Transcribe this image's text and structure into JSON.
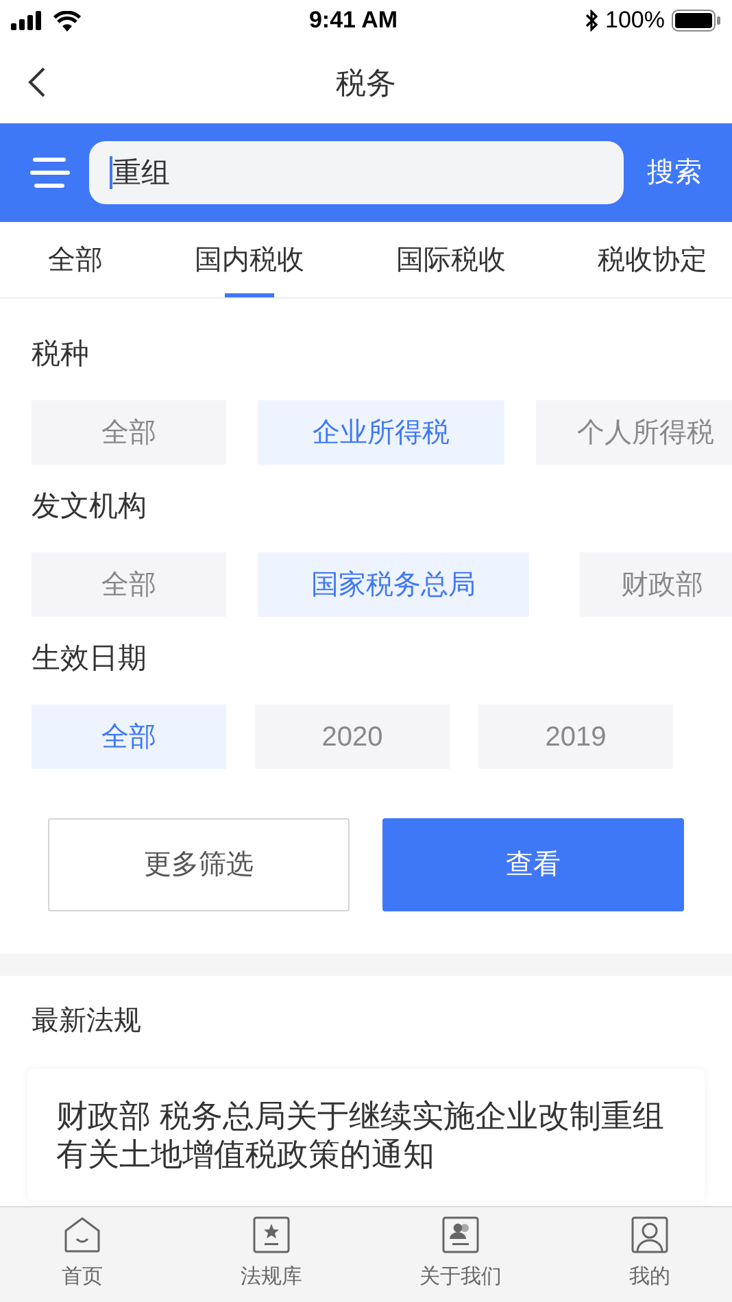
{
  "status_bar": {
    "time": "9:41 AM",
    "battery": "100%"
  },
  "nav": {
    "title": "税务"
  },
  "search": {
    "value": "重组",
    "button": "搜索"
  },
  "tabs": [
    {
      "label": "全部",
      "selected": false
    },
    {
      "label": "国内税收",
      "selected": true
    },
    {
      "label": "国际税收",
      "selected": false
    },
    {
      "label": "税收协定",
      "selected": false
    }
  ],
  "filters": [
    {
      "label": "税种",
      "options": [
        {
          "label": "全部",
          "selected": false
        },
        {
          "label": "企业所得税",
          "selected": true
        },
        {
          "label": "个人所得税",
          "selected": false
        }
      ]
    },
    {
      "label": "发文机构",
      "options": [
        {
          "label": "全部",
          "selected": false
        },
        {
          "label": "国家税务总局",
          "selected": true
        },
        {
          "label": "财政部",
          "selected": false
        }
      ]
    },
    {
      "label": "生效日期",
      "options": [
        {
          "label": "全部",
          "selected": true
        },
        {
          "label": "2020",
          "selected": false
        },
        {
          "label": "2019",
          "selected": false
        }
      ]
    }
  ],
  "actions": {
    "more": "更多筛选",
    "view": "查看"
  },
  "latest": {
    "title": "最新法规",
    "items": [
      {
        "title": "财政部 税务总局关于继续实施企业改制重组有关土地增值税政策的通知"
      }
    ]
  },
  "tab_bar": [
    {
      "label": "首页",
      "kind": "home"
    },
    {
      "label": "法规库",
      "kind": "library"
    },
    {
      "label": "关于我们",
      "kind": "about"
    },
    {
      "label": "我的",
      "kind": "me"
    }
  ]
}
